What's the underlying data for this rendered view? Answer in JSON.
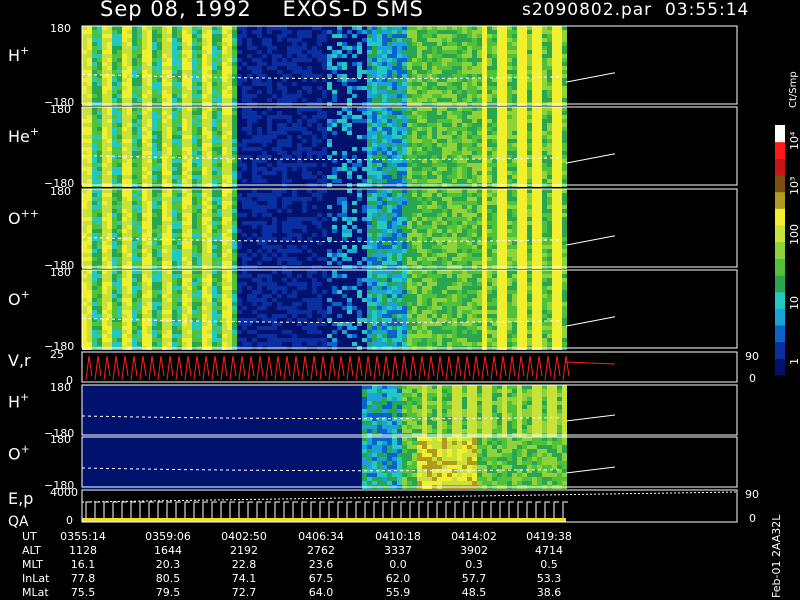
{
  "header": {
    "title": "Sep 08, 1992    EXOS-D SMS",
    "file": "s2090802.par  03:55:14"
  },
  "colorbar": {
    "unit": "Ct/Smp",
    "ticks": [
      "10⁴",
      "10³",
      "100",
      "10",
      "1"
    ]
  },
  "footer": "Feb-01 2AA32L",
  "chart_data": [
    {
      "type": "heatmap",
      "panel": "H+",
      "label": "H",
      "sup": "+",
      "ylim": [
        -180,
        180
      ],
      "ticks": [
        "180",
        "−180"
      ]
    },
    {
      "type": "heatmap",
      "panel": "He+",
      "label": "He",
      "sup": "+",
      "ylim": [
        -180,
        180
      ],
      "ticks": [
        "180",
        "−180"
      ]
    },
    {
      "type": "heatmap",
      "panel": "O++",
      "label": "O",
      "sup": "++",
      "ylim": [
        -180,
        180
      ],
      "ticks": [
        "180",
        "−180"
      ]
    },
    {
      "type": "heatmap",
      "panel": "O+",
      "label": "O",
      "sup": "+",
      "ylim": [
        -180,
        180
      ],
      "ticks": [
        "180",
        "−180"
      ]
    },
    {
      "type": "line",
      "panel": "V,r",
      "label": "V,r",
      "ylim": [
        0,
        25
      ],
      "ticks": [
        "25",
        "0"
      ],
      "right_ticks": [
        "90",
        "0"
      ]
    },
    {
      "type": "heatmap",
      "panel": "H+ (2)",
      "label": "H",
      "sup": "+",
      "ylim": [
        -180,
        180
      ],
      "ticks": [
        "180",
        "−180"
      ]
    },
    {
      "type": "heatmap",
      "panel": "O+ (2)",
      "label": "O",
      "sup": "+",
      "ylim": [
        -180,
        180
      ],
      "ticks": [
        "180",
        "−180"
      ]
    },
    {
      "type": "line",
      "panel": "E,p",
      "label": "E,p",
      "label2": "QA",
      "ylim": [
        0,
        4000
      ],
      "ticks": [
        "4000",
        "0"
      ],
      "right_ticks": [
        "90",
        "0"
      ]
    }
  ],
  "table": {
    "rows": [
      {
        "label": "UT",
        "values": [
          "0355:14",
          "0359:06",
          "0402:50",
          "0406:34",
          "0410:18",
          "0414:02",
          "0419:38"
        ]
      },
      {
        "label": "ALT",
        "values": [
          "1128",
          "1644",
          "2192",
          "2762",
          "3337",
          "3902",
          "4714"
        ]
      },
      {
        "label": "MLT",
        "values": [
          "16.1",
          "20.3",
          "22.8",
          "23.6",
          "0.0",
          "0.3",
          "0.5"
        ]
      },
      {
        "label": "InLat",
        "values": [
          "77.8",
          "80.5",
          "74.1",
          "67.5",
          "62.0",
          "57.7",
          "53.3"
        ]
      },
      {
        "label": "MLat",
        "values": [
          "75.5",
          "79.5",
          "72.7",
          "64.0",
          "55.9",
          "48.5",
          "38.6"
        ]
      }
    ]
  }
}
